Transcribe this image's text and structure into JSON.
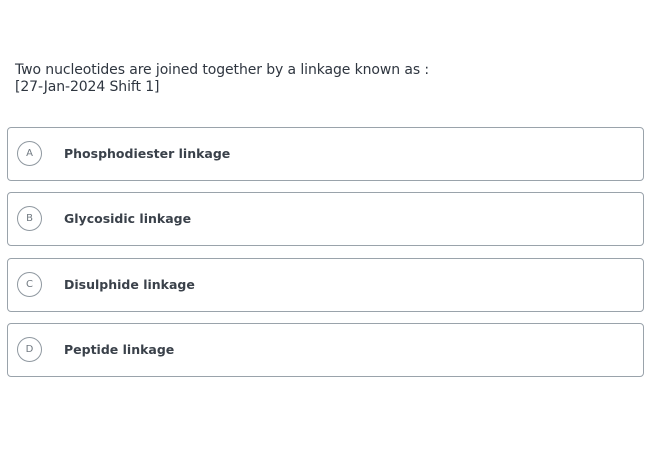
{
  "question": {
    "text": "Two nucleotides are joined together by a linkage known as :",
    "source": "[27-Jan-2024 Shift 1]"
  },
  "options": [
    {
      "letter": "A",
      "label": "Phosphodiester linkage"
    },
    {
      "letter": "B",
      "label": "Glycosidic linkage"
    },
    {
      "letter": "C",
      "label": "Disulphide linkage"
    },
    {
      "letter": "D",
      "label": "Peptide linkage"
    }
  ],
  "colors": {
    "text": "#2f3640",
    "option_border": "#9aa3ab",
    "badge_text": "#6f7880"
  }
}
